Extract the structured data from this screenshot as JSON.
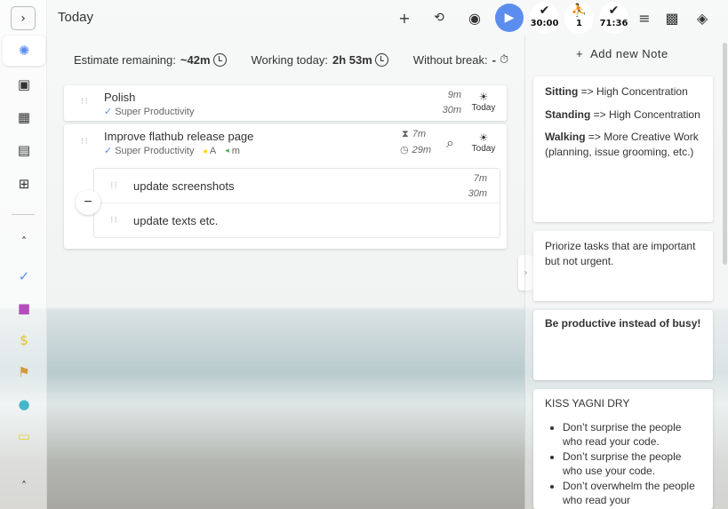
{
  "header": {
    "title": "Today",
    "timers": [
      {
        "value": "30:00"
      },
      {
        "value": "1"
      },
      {
        "value": "71:36"
      }
    ]
  },
  "stats": {
    "estimate_label": "Estimate remaining:",
    "estimate_value": "~42m",
    "working_label": "Working today:",
    "working_value": "2h 53m",
    "break_label": "Without break:",
    "break_value": "-"
  },
  "tasks": [
    {
      "title": "Polish",
      "project": "Super Productivity",
      "spent": "9m",
      "estimate": "30m",
      "day": "Today"
    },
    {
      "title": "Improve flathub release page",
      "project": "Super Productivity",
      "tags": [
        "A",
        "m"
      ],
      "spent": "7m",
      "estimate": "29m",
      "day": "Today",
      "subtasks": [
        {
          "title": "update screenshots",
          "spent": "7m",
          "estimate": "30m"
        },
        {
          "title": "update texts etc."
        }
      ]
    }
  ],
  "notes_panel": {
    "add_label": "Add new Note"
  },
  "notes": [
    {
      "lines": [
        {
          "b": "Sitting",
          "t": " => High Concentration"
        },
        {
          "b": "Standing",
          "t": " => High Concentration"
        },
        {
          "b": "Walking",
          "t": " => More Creative Work (planning, issue grooming, etc.)"
        }
      ]
    },
    {
      "text": "Priorize tasks that are important but not urgent."
    },
    {
      "bold": "Be productive instead of busy!"
    },
    {
      "title": "KISS YAGNI DRY",
      "items": [
        "Don’t surprise the people who read your code.",
        "Don’t surprise the people who use your code.",
        "Don’t overwhelm the people who read your"
      ]
    }
  ],
  "colors": {
    "accent": "#5b8def",
    "tag_a": "#ffd600",
    "tag_m": "#4caf50"
  }
}
